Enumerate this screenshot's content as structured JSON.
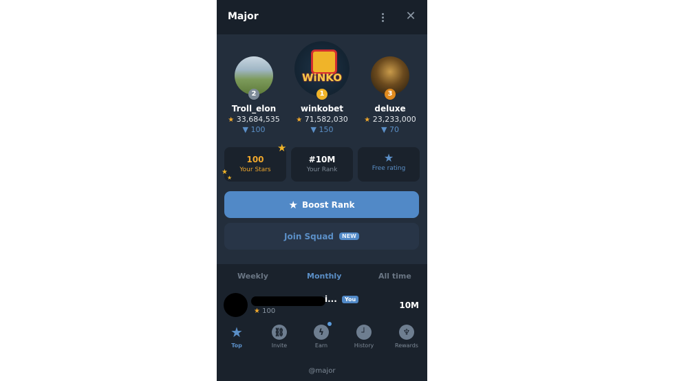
{
  "header": {
    "title": "Major",
    "menu_icon": "more-vertical-icon",
    "close_icon": "close-icon"
  },
  "podium": [
    {
      "rank": "2",
      "name": "Troll_elon",
      "stars": "33,684,535",
      "gems": "100",
      "badge_color": "#7d8a98"
    },
    {
      "rank": "1",
      "name": "winkobet",
      "stars": "71,582,030",
      "gems": "150",
      "badge_color": "#f0b429",
      "avatar_text": "WiNKO"
    },
    {
      "rank": "3",
      "name": "deluxe",
      "stars": "23,233,000",
      "gems": "70",
      "badge_color": "#e08a1e"
    }
  ],
  "cards": {
    "stars": {
      "value": "100",
      "label": "Your Stars"
    },
    "rank": {
      "value": "#10M",
      "label": "Your Rank"
    },
    "free": {
      "label": "Free rating"
    }
  },
  "buttons": {
    "boost": "Boost Rank",
    "squad": "Join Squad",
    "new_badge": "NEW"
  },
  "tabs": [
    {
      "label": "Weekly"
    },
    {
      "label": "Monthly",
      "active": true
    },
    {
      "label": "All time"
    }
  ],
  "me": {
    "name_tail": "i...",
    "you_badge": "You",
    "stars": "100",
    "rank": "10M"
  },
  "nav": [
    {
      "label": "Top",
      "icon": "top-stars-icon",
      "active": true
    },
    {
      "label": "Invite",
      "icon": "link-icon"
    },
    {
      "label": "Earn",
      "icon": "lightning-icon",
      "notification": true
    },
    {
      "label": "History",
      "icon": "clock-icon"
    },
    {
      "label": "Rewards",
      "icon": "trophy-icon"
    }
  ],
  "footer": "@major",
  "colors": {
    "accent": "#5189c7",
    "gold": "#f0b429",
    "bg": "#232e3c"
  }
}
